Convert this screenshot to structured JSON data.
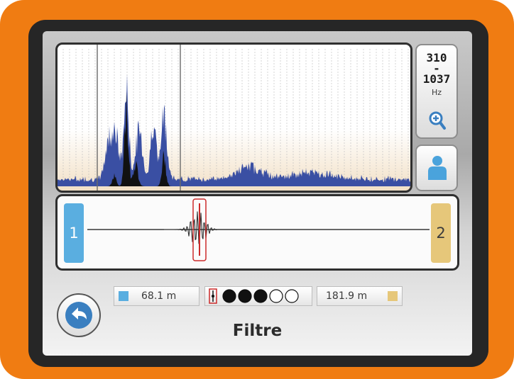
{
  "frequency": {
    "low": "310",
    "dash": "-",
    "high": "1037",
    "unit": "Hz"
  },
  "sensors": {
    "left_label": "1",
    "right_label": "2"
  },
  "distances": {
    "left": "68.1 m",
    "right": "181.9 m"
  },
  "sensitivity": {
    "filled": 3,
    "total": 5
  },
  "title": "Filtre",
  "colors": {
    "accent_frame": "#f07c12",
    "sensor_1": "#5aaee0",
    "sensor_2": "#e6c77a",
    "spectrum": "#3a4fa3",
    "marker": "#cc2b2b"
  },
  "icons": {
    "zoom": "zoom-in-icon",
    "person": "person-icon",
    "back": "back-arrow-icon"
  }
}
